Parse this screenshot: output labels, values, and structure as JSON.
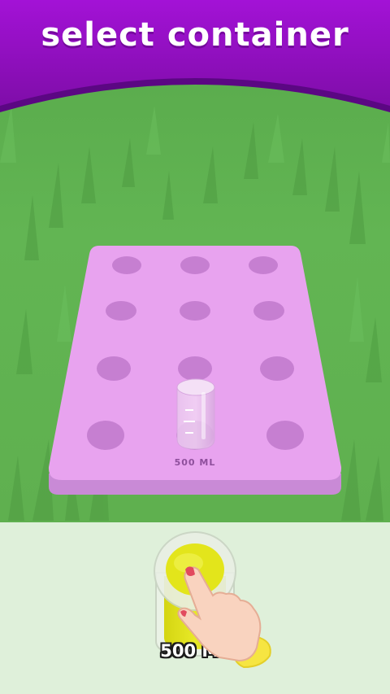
{
  "header": {
    "title": "select container"
  },
  "tray": {
    "slot_count": 12,
    "placed_container_label": "500 ML"
  },
  "options": [
    {
      "label": "500 ML",
      "liquid_color": "#e5e61a"
    }
  ],
  "colors": {
    "banner": "#8a0fb8",
    "tray": "#e8a3ef",
    "grass": "#5fb34f",
    "bottom_panel": "#dff0da"
  },
  "icons": [
    "pointing-hand-icon",
    "beaker-icon"
  ]
}
